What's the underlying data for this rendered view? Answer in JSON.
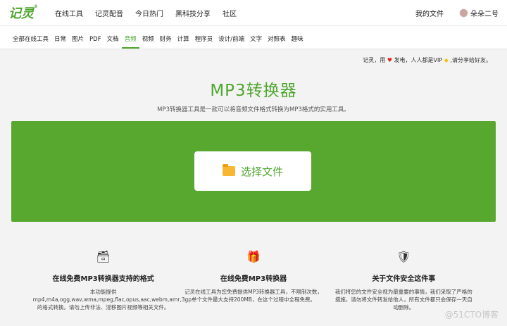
{
  "brand": {
    "name": "记灵",
    "mark": "®"
  },
  "top_links": [
    "在线工具",
    "记灵配音",
    "今日热门",
    "黑科技分享",
    "社区"
  ],
  "top_right": {
    "files": "我的文件",
    "user": "朵朵二号"
  },
  "categories": [
    "全部在线工具",
    "日常",
    "图片",
    "PDF",
    "文档",
    "音频",
    "视频",
    "财务",
    "计算",
    "程序员",
    "设计/前端",
    "文字",
    "对照表",
    "趣味"
  ],
  "active_category": "音频",
  "notice": {
    "prefix": "记灵，用",
    "mid": "发电，人人都是VIP",
    "suffix": ",请分享给好友。"
  },
  "title": "MP3转换器",
  "description": "MP3转换器工具是一款可以将音频文件格式转换为MP3格式的实用工具。",
  "select_button": "选择文件",
  "features": [
    {
      "icon": "🗃",
      "title": "在线免费MP3转换器支持的格式",
      "text": "本功能提供 mp4,m4a,ogg,wav,wma,mpeg,flac,opus,aac,webm,amr,3gp的格式转换。请勿上传非法、淫秽图片视频等相关文件。"
    },
    {
      "icon": "🎁",
      "title": "在线免费MP3转换器",
      "text": "记灵在线工具为您免费提供MP3转换器工具，不限制次数，单个文件最大支持200MB，在这个过程中全程免费。"
    },
    {
      "icon": "🛡",
      "title": "关于文件安全这件事",
      "text": "我们将您的文件安全视为最重要的事情，我们采取了严格的措施，请勿将文件转发给他人，所有文件都只会保存一天自动删除。"
    }
  ],
  "watermark": "@51CTO博客"
}
